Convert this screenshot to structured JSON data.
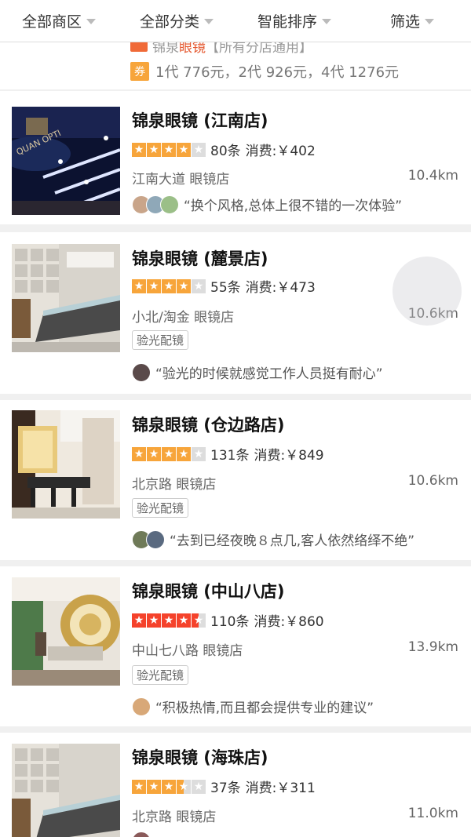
{
  "filters": [
    "全部商区",
    "全部分类",
    "智能排序",
    "筛选"
  ],
  "partial": {
    "prev_line_prefix": "锦泉",
    "prev_line_highlight": "眼镜",
    "prev_line_suffix": "【所有分店通用】",
    "coupon_badge": "券",
    "coupon_text": "1代 776元，2代 926元，4代 1276元"
  },
  "colors": {
    "star_orange": "#f7a53b",
    "star_red": "#f5422b",
    "star_empty": "#dddddd"
  },
  "stores": [
    {
      "name": "锦泉眼镜 (江南店)",
      "rating": 4,
      "star_color": "orange",
      "reviews": "80条",
      "price": "消费:￥402",
      "area": "江南大道",
      "category": "眼镜店",
      "distance": "10.4km",
      "tag": "",
      "review_quote": "“换个风格,总体上很不错的一次体验”"
    },
    {
      "name": "锦泉眼镜 (麓景店)",
      "rating": 4,
      "star_color": "orange",
      "reviews": "55条",
      "price": "消费:￥473",
      "area": "小北/淘金",
      "category": "眼镜店",
      "distance": "10.6km",
      "tag": "验光配镜",
      "review_quote": "“验光的时候就感觉工作人员挺有耐心”"
    },
    {
      "name": "锦泉眼镜 (仓边路店)",
      "rating": 4,
      "star_color": "orange",
      "reviews": "131条",
      "price": "消费:￥849",
      "area": "北京路",
      "category": "眼镜店",
      "distance": "10.6km",
      "tag": "验光配镜",
      "review_quote": "“去到已经夜晚８点几,客人依然络绎不绝”"
    },
    {
      "name": "锦泉眼镜 (中山八店)",
      "rating": 4.5,
      "star_color": "red",
      "reviews": "110条",
      "price": "消费:￥860",
      "area": "中山七八路",
      "category": "眼镜店",
      "distance": "13.9km",
      "tag": "验光配镜",
      "review_quote": "“积极热情,而且都会提供专业的建议”"
    },
    {
      "name": "锦泉眼镜 (海珠店)",
      "rating": 3.5,
      "star_color": "orange",
      "reviews": "37条",
      "price": "消费:￥311",
      "area": "北京路",
      "category": "眼镜店",
      "distance": "11.0km",
      "tag": "",
      "review_quote": ""
    }
  ]
}
